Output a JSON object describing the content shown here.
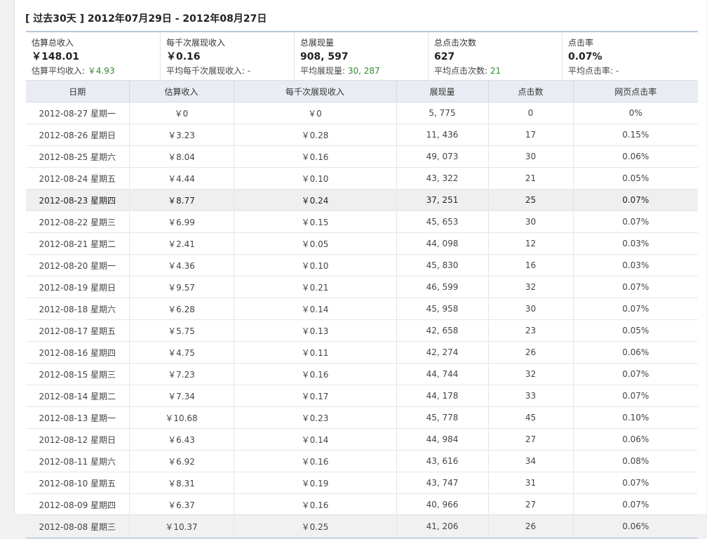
{
  "header": {
    "range_label": "[ 过去30天 ]",
    "date_range": "2012年07月29日 - 2012年08月27日"
  },
  "summary": [
    {
      "label": "估算总收入",
      "value": "￥148.01",
      "sub_label": "估算平均收入: ",
      "sub_value": "￥4.93"
    },
    {
      "label": "每千次展现收入",
      "value": "￥0.16",
      "sub_label": "平均每千次展现收入: ",
      "sub_value": "-"
    },
    {
      "label": "总展现量",
      "value": "908, 597",
      "sub_label": "平均展现量: ",
      "sub_value": "30, 287"
    },
    {
      "label": "总点击次数",
      "value": "627",
      "sub_label": "平均点击次数: ",
      "sub_value": "21"
    },
    {
      "label": "点击率",
      "value": "0.07%",
      "sub_label": "平均点击率: ",
      "sub_value": "-"
    }
  ],
  "table": {
    "columns": [
      "日期",
      "估算收入",
      "每千次展现收入",
      "展现量",
      "点击数",
      "网页点击率"
    ],
    "highlighted_row": 4,
    "rows": [
      [
        "2012-08-27 星期一",
        "￥0",
        "￥0",
        "5, 775",
        "0",
        "0%"
      ],
      [
        "2012-08-26 星期日",
        "￥3.23",
        "￥0.28",
        "11, 436",
        "17",
        "0.15%"
      ],
      [
        "2012-08-25 星期六",
        "￥8.04",
        "￥0.16",
        "49, 073",
        "30",
        "0.06%"
      ],
      [
        "2012-08-24 星期五",
        "￥4.44",
        "￥0.10",
        "43, 322",
        "21",
        "0.05%"
      ],
      [
        "2012-08-23 星期四",
        "￥8.77",
        "￥0.24",
        "37, 251",
        "25",
        "0.07%"
      ],
      [
        "2012-08-22 星期三",
        "￥6.99",
        "￥0.15",
        "45, 653",
        "30",
        "0.07%"
      ],
      [
        "2012-08-21 星期二",
        "￥2.41",
        "￥0.05",
        "44, 098",
        "12",
        "0.03%"
      ],
      [
        "2012-08-20 星期一",
        "￥4.36",
        "￥0.10",
        "45, 830",
        "16",
        "0.03%"
      ],
      [
        "2012-08-19 星期日",
        "￥9.57",
        "￥0.21",
        "46, 599",
        "32",
        "0.07%"
      ],
      [
        "2012-08-18 星期六",
        "￥6.28",
        "￥0.14",
        "45, 958",
        "30",
        "0.07%"
      ],
      [
        "2012-08-17 星期五",
        "￥5.75",
        "￥0.13",
        "42, 658",
        "23",
        "0.05%"
      ],
      [
        "2012-08-16 星期四",
        "￥4.75",
        "￥0.11",
        "42, 274",
        "26",
        "0.06%"
      ],
      [
        "2012-08-15 星期三",
        "￥7.23",
        "￥0.16",
        "44, 744",
        "32",
        "0.07%"
      ],
      [
        "2012-08-14 星期二",
        "￥7.34",
        "￥0.17",
        "44, 178",
        "33",
        "0.07%"
      ],
      [
        "2012-08-13 星期一",
        "￥10.68",
        "￥0.23",
        "45, 778",
        "45",
        "0.10%"
      ],
      [
        "2012-08-12 星期日",
        "￥6.43",
        "￥0.14",
        "44, 984",
        "27",
        "0.06%"
      ],
      [
        "2012-08-11 星期六",
        "￥6.92",
        "￥0.16",
        "43, 616",
        "34",
        "0.08%"
      ],
      [
        "2012-08-10 星期五",
        "￥8.31",
        "￥0.19",
        "43, 747",
        "31",
        "0.07%"
      ],
      [
        "2012-08-09 星期四",
        "￥6.37",
        "￥0.16",
        "40, 966",
        "27",
        "0.07%"
      ],
      [
        "2012-08-08 星期三",
        "￥10.37",
        "￥0.25",
        "41, 206",
        "26",
        "0.06%"
      ]
    ]
  }
}
